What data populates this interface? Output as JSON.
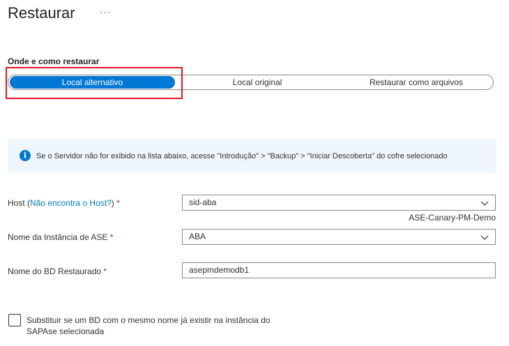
{
  "page": {
    "title": "Restaurar",
    "more_label": "···"
  },
  "restore": {
    "section_label": "Onde e como restaurar",
    "options": [
      {
        "label": "Local alternativo",
        "selected": true
      },
      {
        "label": "Local original",
        "selected": false
      },
      {
        "label": "Restaurar como arquivos",
        "selected": false
      }
    ]
  },
  "info": {
    "icon": "info-icon",
    "icon_glyph": "i",
    "text": "Se o Servidor não for exibido na lista abaixo, acesse \"Introdução\" > \"Backup\" > \"Iniciar Descoberta\" do cofre selecionado"
  },
  "form": {
    "host": {
      "label": "Host",
      "link_open": " (",
      "link": "Não encontra o Host?",
      "link_close": ")",
      "required": " *",
      "value": "sid-aba",
      "subtext": "ASE-Canary-PM-Demo"
    },
    "instance": {
      "label": "Nome da Instância de ASE",
      "required": " *",
      "value": "ABA"
    },
    "db_name": {
      "label": "Nome do BD Restaurado",
      "required": " *",
      "value": "asepmdemodb1"
    },
    "overwrite": {
      "label": "Substituir se um BD com o mesmo nome já existir na instância do SAPAse selecionada",
      "checked": false
    }
  },
  "colors": {
    "accent": "#0078d4",
    "highlight": "#e81123",
    "info_bg": "#eff6fc",
    "required": "#a4262c"
  }
}
